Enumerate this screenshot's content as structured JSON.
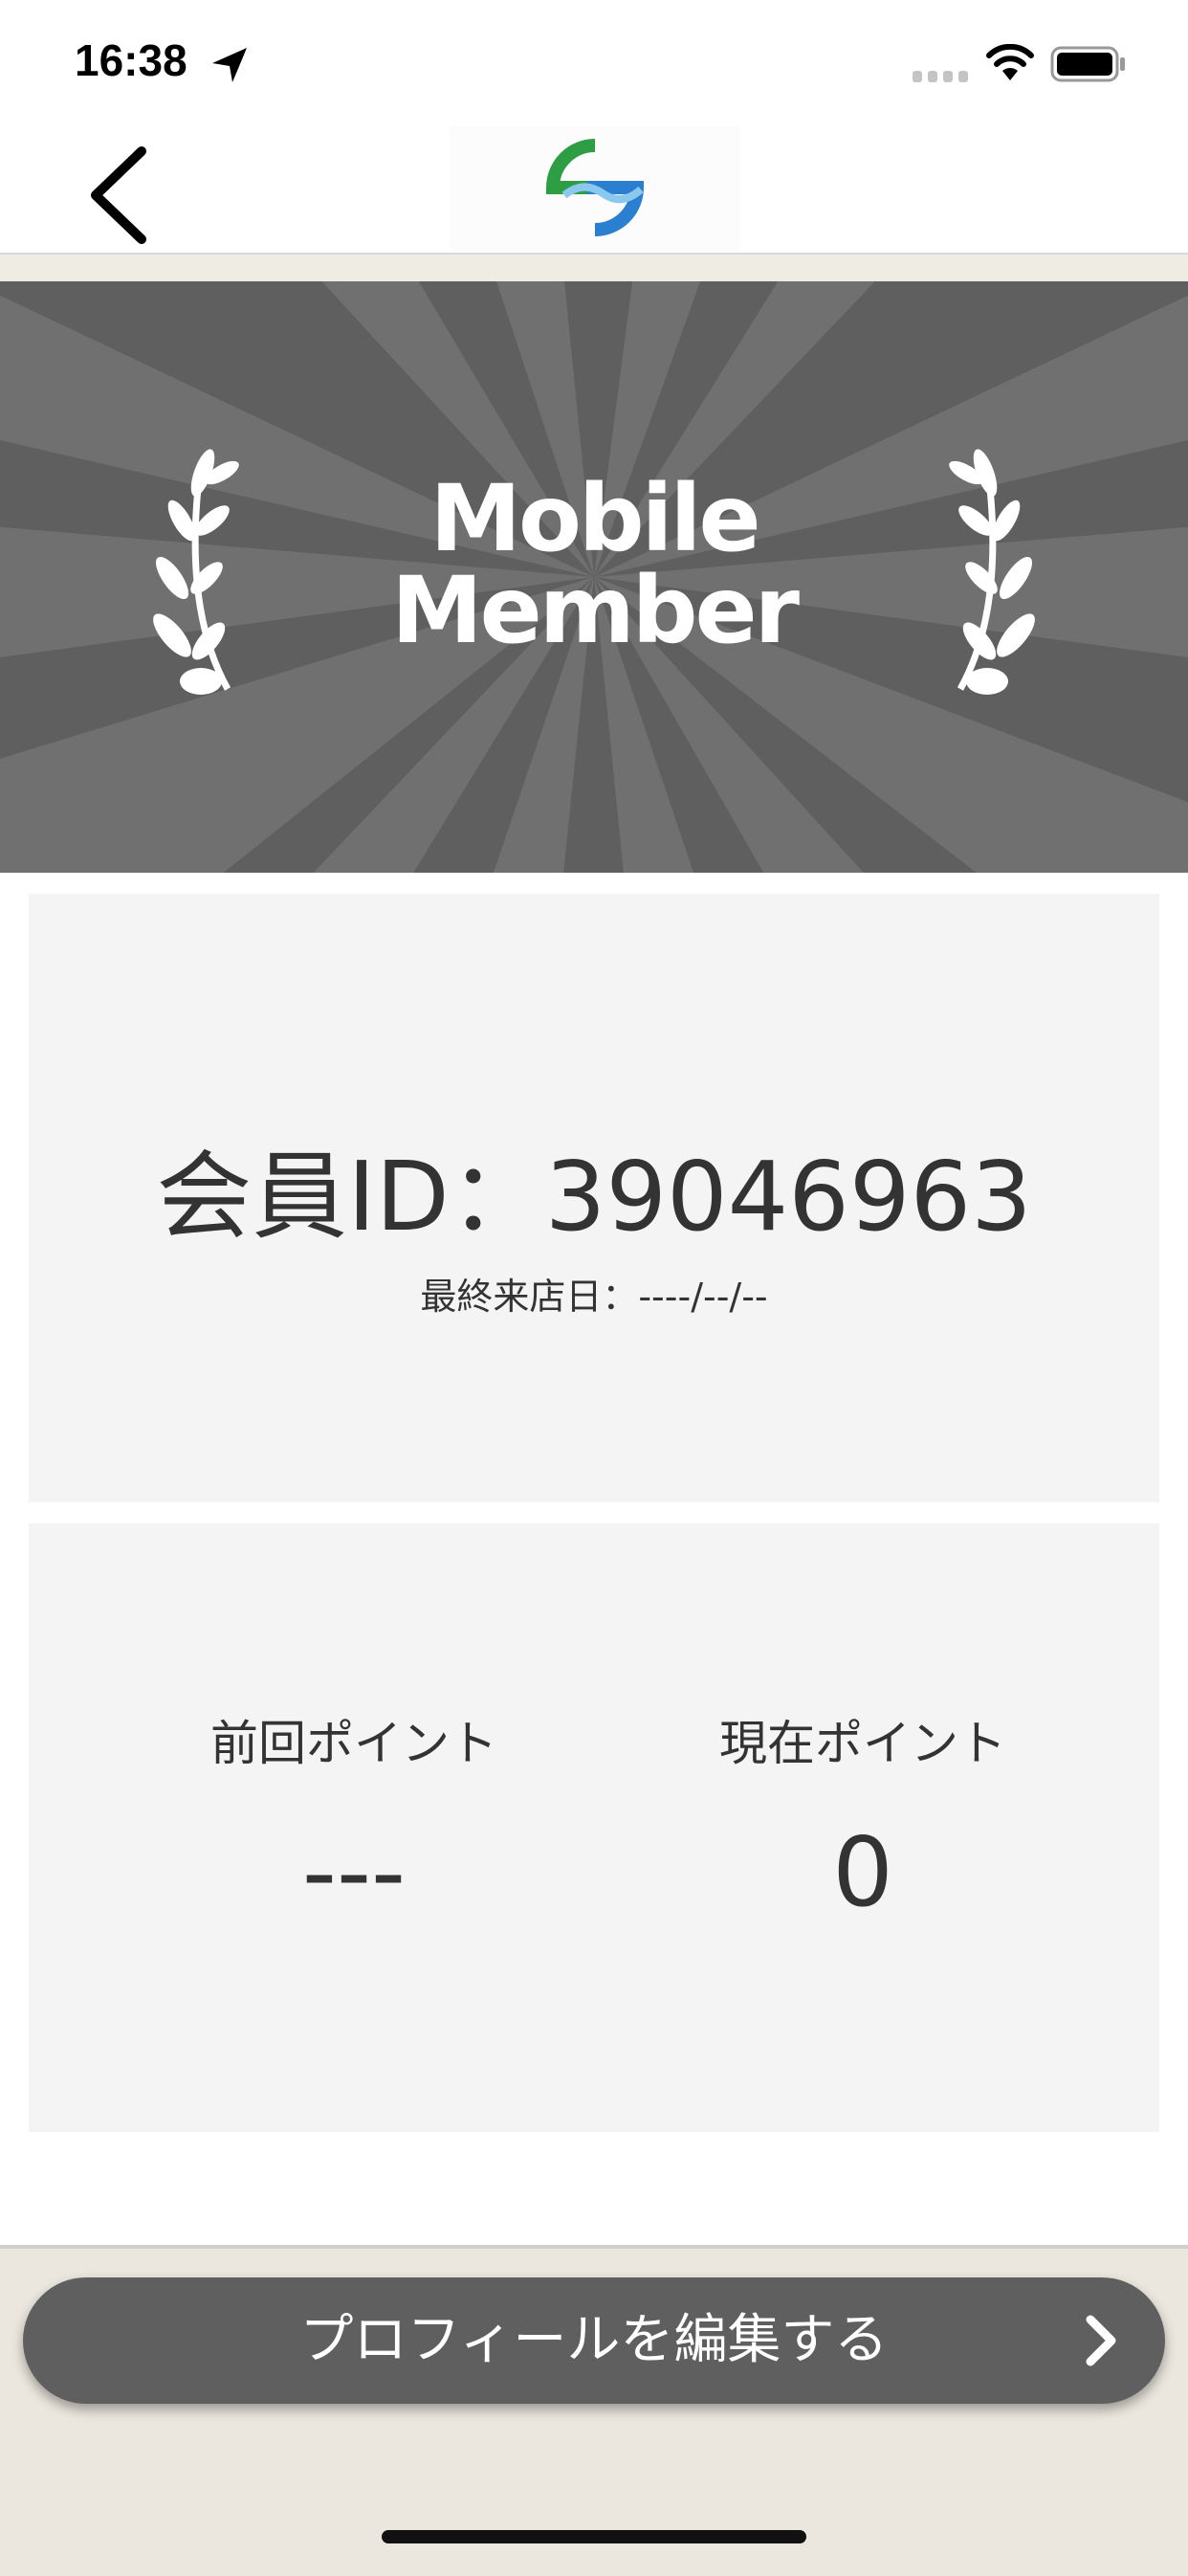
{
  "status_bar": {
    "time": "16:38"
  },
  "nav": {
    "back_label": "",
    "logo_icon": "wave-logo-icon"
  },
  "hero": {
    "title_line1": "Mobile",
    "title_line2": "Member"
  },
  "member": {
    "id_text": "会員ID：39046963",
    "last_visit_text": "最終来店日：----/--/--"
  },
  "points": {
    "previous_label": "前回ポイント",
    "previous_value": "---",
    "current_label": "現在ポイント",
    "current_value": "0"
  },
  "footer": {
    "edit_profile_label": "プロフィールを編集する"
  },
  "colors": {
    "banner_gray": "#5f5f5f",
    "card_bg": "#f4f4f4",
    "button_gray": "#5f5f5f",
    "logo_green": "#2e9e44",
    "logo_blue": "#2a7fd1"
  }
}
